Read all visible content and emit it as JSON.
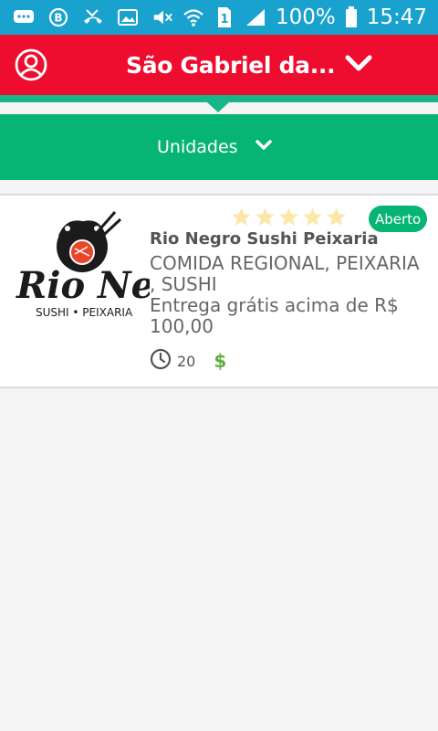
{
  "status_bar": {
    "battery": "100%",
    "time": "15:47",
    "sim": "1",
    "icons": [
      "chat-icon",
      "b-icon",
      "missed-call-icon",
      "photo-icon",
      "mute-icon",
      "wifi-icon",
      "signal-icon",
      "battery-icon"
    ]
  },
  "header": {
    "city": "São Gabriel da...",
    "profile_icon": "user-circle-icon"
  },
  "units": {
    "label": "Unidades"
  },
  "restaurant": {
    "logo_text": "Rio Negro",
    "logo_sub": "SUSHI • PEIXARIA",
    "name": "Rio Negro Sushi Peixaria",
    "categories": "COMIDA REGIONAL, PEIXARIA , SUSHI",
    "delivery": "Entrega grátis acima de R$ 100,00",
    "status": "Aberto",
    "time": "20",
    "price": "$",
    "rating": 0
  },
  "colors": {
    "status_bar": "#1aa2cf",
    "header": "#ee0d2e",
    "accent_green": "#06b473",
    "star": "#fbe7a7",
    "price": "#5eb13f"
  }
}
